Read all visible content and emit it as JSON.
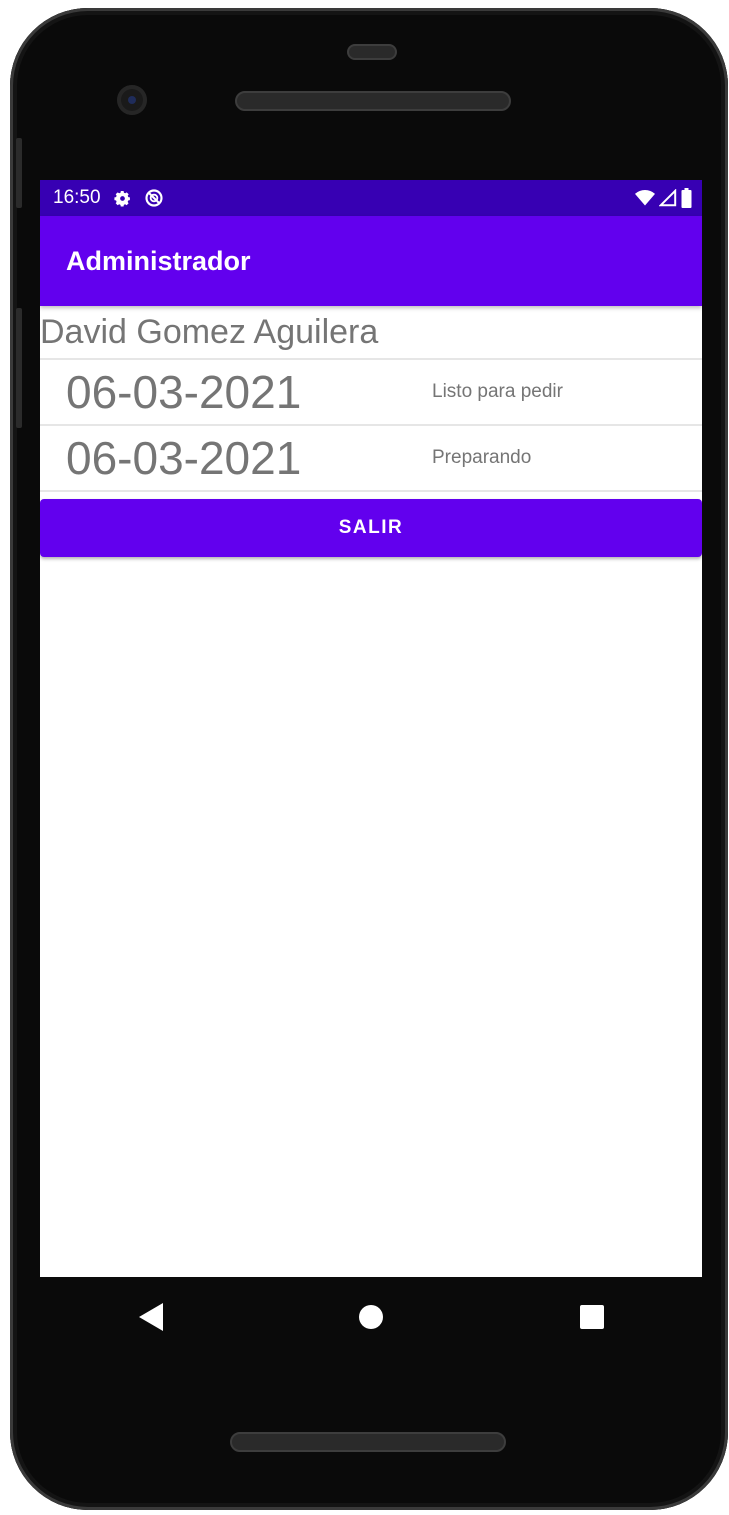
{
  "status_bar": {
    "time": "16:50",
    "left_icons": [
      "gear-icon",
      "no-disturb-icon"
    ],
    "right_icons": [
      "wifi-icon",
      "signal-icon",
      "battery-icon"
    ]
  },
  "app_bar": {
    "title": "Administrador"
  },
  "user": {
    "name": "David Gomez Aguilera"
  },
  "orders": [
    {
      "date": "06-03-2021",
      "status": "Listo para pedir"
    },
    {
      "date": "06-03-2021",
      "status": "Preparando"
    }
  ],
  "actions": {
    "logout_label": "SALIR"
  },
  "nav_bar": {
    "buttons": [
      "back-icon",
      "home-icon",
      "recents-icon"
    ]
  },
  "colors": {
    "status_bar": "#3700b3",
    "primary": "#6200ee",
    "text_secondary": "#757575"
  }
}
